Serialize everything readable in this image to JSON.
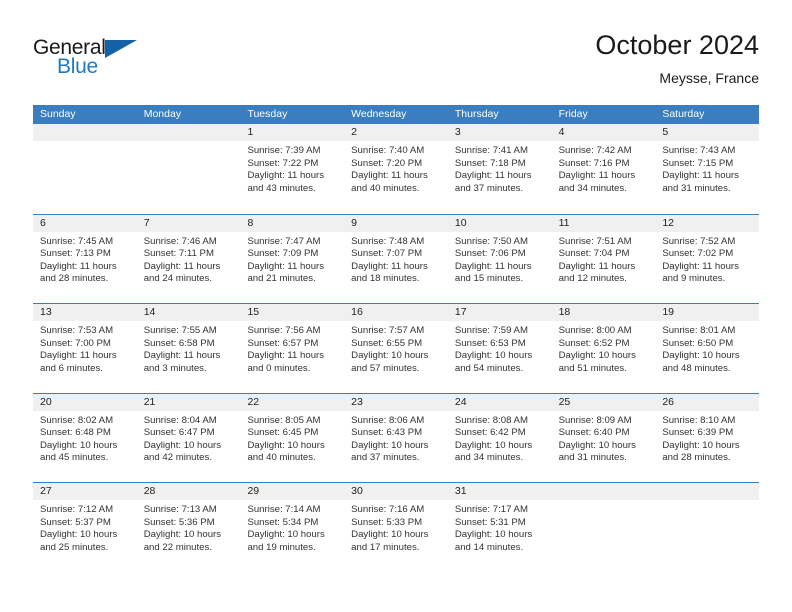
{
  "brand": {
    "word_general": "General",
    "word_blue": "Blue",
    "accent_color": "#1f7ac4",
    "triangle_color": "#1362a8"
  },
  "header": {
    "title": "October 2024",
    "subtitle": "Meysse, France"
  },
  "calendar": {
    "header_bg": "#3a7ebf",
    "day_bar_bg": "#f0f0f0",
    "weekdays": [
      "Sunday",
      "Monday",
      "Tuesday",
      "Wednesday",
      "Thursday",
      "Friday",
      "Saturday"
    ],
    "weeks": [
      [
        {
          "day": "",
          "sunrise": "",
          "sunset": "",
          "daylight": "",
          "empty": true
        },
        {
          "day": "",
          "sunrise": "",
          "sunset": "",
          "daylight": "",
          "empty": true
        },
        {
          "day": "1",
          "sunrise": "Sunrise: 7:39 AM",
          "sunset": "Sunset: 7:22 PM",
          "daylight": "Daylight: 11 hours and 43 minutes."
        },
        {
          "day": "2",
          "sunrise": "Sunrise: 7:40 AM",
          "sunset": "Sunset: 7:20 PM",
          "daylight": "Daylight: 11 hours and 40 minutes."
        },
        {
          "day": "3",
          "sunrise": "Sunrise: 7:41 AM",
          "sunset": "Sunset: 7:18 PM",
          "daylight": "Daylight: 11 hours and 37 minutes."
        },
        {
          "day": "4",
          "sunrise": "Sunrise: 7:42 AM",
          "sunset": "Sunset: 7:16 PM",
          "daylight": "Daylight: 11 hours and 34 minutes."
        },
        {
          "day": "5",
          "sunrise": "Sunrise: 7:43 AM",
          "sunset": "Sunset: 7:15 PM",
          "daylight": "Daylight: 11 hours and 31 minutes."
        }
      ],
      [
        {
          "day": "6",
          "sunrise": "Sunrise: 7:45 AM",
          "sunset": "Sunset: 7:13 PM",
          "daylight": "Daylight: 11 hours and 28 minutes."
        },
        {
          "day": "7",
          "sunrise": "Sunrise: 7:46 AM",
          "sunset": "Sunset: 7:11 PM",
          "daylight": "Daylight: 11 hours and 24 minutes."
        },
        {
          "day": "8",
          "sunrise": "Sunrise: 7:47 AM",
          "sunset": "Sunset: 7:09 PM",
          "daylight": "Daylight: 11 hours and 21 minutes."
        },
        {
          "day": "9",
          "sunrise": "Sunrise: 7:48 AM",
          "sunset": "Sunset: 7:07 PM",
          "daylight": "Daylight: 11 hours and 18 minutes."
        },
        {
          "day": "10",
          "sunrise": "Sunrise: 7:50 AM",
          "sunset": "Sunset: 7:06 PM",
          "daylight": "Daylight: 11 hours and 15 minutes."
        },
        {
          "day": "11",
          "sunrise": "Sunrise: 7:51 AM",
          "sunset": "Sunset: 7:04 PM",
          "daylight": "Daylight: 11 hours and 12 minutes."
        },
        {
          "day": "12",
          "sunrise": "Sunrise: 7:52 AM",
          "sunset": "Sunset: 7:02 PM",
          "daylight": "Daylight: 11 hours and 9 minutes."
        }
      ],
      [
        {
          "day": "13",
          "sunrise": "Sunrise: 7:53 AM",
          "sunset": "Sunset: 7:00 PM",
          "daylight": "Daylight: 11 hours and 6 minutes."
        },
        {
          "day": "14",
          "sunrise": "Sunrise: 7:55 AM",
          "sunset": "Sunset: 6:58 PM",
          "daylight": "Daylight: 11 hours and 3 minutes."
        },
        {
          "day": "15",
          "sunrise": "Sunrise: 7:56 AM",
          "sunset": "Sunset: 6:57 PM",
          "daylight": "Daylight: 11 hours and 0 minutes."
        },
        {
          "day": "16",
          "sunrise": "Sunrise: 7:57 AM",
          "sunset": "Sunset: 6:55 PM",
          "daylight": "Daylight: 10 hours and 57 minutes."
        },
        {
          "day": "17",
          "sunrise": "Sunrise: 7:59 AM",
          "sunset": "Sunset: 6:53 PM",
          "daylight": "Daylight: 10 hours and 54 minutes."
        },
        {
          "day": "18",
          "sunrise": "Sunrise: 8:00 AM",
          "sunset": "Sunset: 6:52 PM",
          "daylight": "Daylight: 10 hours and 51 minutes."
        },
        {
          "day": "19",
          "sunrise": "Sunrise: 8:01 AM",
          "sunset": "Sunset: 6:50 PM",
          "daylight": "Daylight: 10 hours and 48 minutes."
        }
      ],
      [
        {
          "day": "20",
          "sunrise": "Sunrise: 8:02 AM",
          "sunset": "Sunset: 6:48 PM",
          "daylight": "Daylight: 10 hours and 45 minutes."
        },
        {
          "day": "21",
          "sunrise": "Sunrise: 8:04 AM",
          "sunset": "Sunset: 6:47 PM",
          "daylight": "Daylight: 10 hours and 42 minutes."
        },
        {
          "day": "22",
          "sunrise": "Sunrise: 8:05 AM",
          "sunset": "Sunset: 6:45 PM",
          "daylight": "Daylight: 10 hours and 40 minutes."
        },
        {
          "day": "23",
          "sunrise": "Sunrise: 8:06 AM",
          "sunset": "Sunset: 6:43 PM",
          "daylight": "Daylight: 10 hours and 37 minutes."
        },
        {
          "day": "24",
          "sunrise": "Sunrise: 8:08 AM",
          "sunset": "Sunset: 6:42 PM",
          "daylight": "Daylight: 10 hours and 34 minutes."
        },
        {
          "day": "25",
          "sunrise": "Sunrise: 8:09 AM",
          "sunset": "Sunset: 6:40 PM",
          "daylight": "Daylight: 10 hours and 31 minutes."
        },
        {
          "day": "26",
          "sunrise": "Sunrise: 8:10 AM",
          "sunset": "Sunset: 6:39 PM",
          "daylight": "Daylight: 10 hours and 28 minutes."
        }
      ],
      [
        {
          "day": "27",
          "sunrise": "Sunrise: 7:12 AM",
          "sunset": "Sunset: 5:37 PM",
          "daylight": "Daylight: 10 hours and 25 minutes."
        },
        {
          "day": "28",
          "sunrise": "Sunrise: 7:13 AM",
          "sunset": "Sunset: 5:36 PM",
          "daylight": "Daylight: 10 hours and 22 minutes."
        },
        {
          "day": "29",
          "sunrise": "Sunrise: 7:14 AM",
          "sunset": "Sunset: 5:34 PM",
          "daylight": "Daylight: 10 hours and 19 minutes."
        },
        {
          "day": "30",
          "sunrise": "Sunrise: 7:16 AM",
          "sunset": "Sunset: 5:33 PM",
          "daylight": "Daylight: 10 hours and 17 minutes."
        },
        {
          "day": "31",
          "sunrise": "Sunrise: 7:17 AM",
          "sunset": "Sunset: 5:31 PM",
          "daylight": "Daylight: 10 hours and 14 minutes."
        },
        {
          "day": "",
          "sunrise": "",
          "sunset": "",
          "daylight": "",
          "empty": true
        },
        {
          "day": "",
          "sunrise": "",
          "sunset": "",
          "daylight": "",
          "empty": true
        }
      ]
    ]
  }
}
